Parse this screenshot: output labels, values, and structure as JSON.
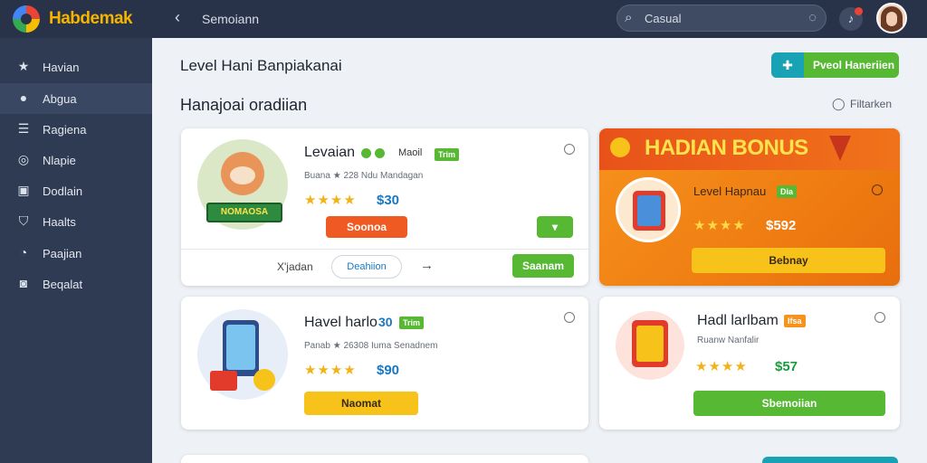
{
  "app": {
    "brand": "Habdemak",
    "section": "Semoiann"
  },
  "search": {
    "value": "Casual"
  },
  "sidebar": {
    "items": [
      {
        "label": "Havian",
        "icon": "star-icon"
      },
      {
        "label": "Abgua",
        "icon": "user-icon"
      },
      {
        "label": "Ragiena",
        "icon": "list-icon"
      },
      {
        "label": "Nlapie",
        "icon": "shield-icon"
      },
      {
        "label": "Dodlain",
        "icon": "display-icon"
      },
      {
        "label": "Haalts",
        "icon": "badge-icon"
      },
      {
        "label": "Paajian",
        "icon": "chat-icon"
      },
      {
        "label": "Beqalat",
        "icon": "square-icon"
      }
    ],
    "active_index": 1
  },
  "main": {
    "page_title": "Level Hani Banpiakanai",
    "section_title": "Hanajoai oradiian",
    "top_button": "Pveol Haneriien",
    "filter_label": "Filtarken"
  },
  "cards": [
    {
      "title": "Levaian",
      "tag": "Maoil",
      "tag_badge": "Trim",
      "sub": "Buana ★ 228 Ndu Mandagan",
      "rating": 4,
      "price": "$30",
      "art_banner": "NOMAOSA",
      "button": "Soonoa",
      "footer_label": "X'jadan",
      "footer_link": "Deahiion",
      "footer_button": "Saanam"
    },
    {
      "title": "Havel harlo",
      "title_suffix": "30",
      "tag": "Trim",
      "sub": "Panab ★ 26308 Iuma Senadnem",
      "rating": 4,
      "price": "$90",
      "button": "Naomat"
    },
    {
      "title": "Hadl larlbam",
      "tag": "Ifsa",
      "sub": "Ruanw Nanfalir",
      "rating": 4,
      "price": "$57",
      "button": "Sbemoiian"
    }
  ],
  "bonus": {
    "title": "HADIAN BONUS",
    "item_title": "Level Hapnau",
    "tag": "Dia",
    "rating": 4,
    "price": "$592",
    "button": "Bebnay"
  },
  "colors": {
    "green": "#56b833",
    "orange": "#f7921d",
    "yellow": "#f7c21a",
    "sidebar": "#2f3b52",
    "topbar": "#28334a"
  }
}
